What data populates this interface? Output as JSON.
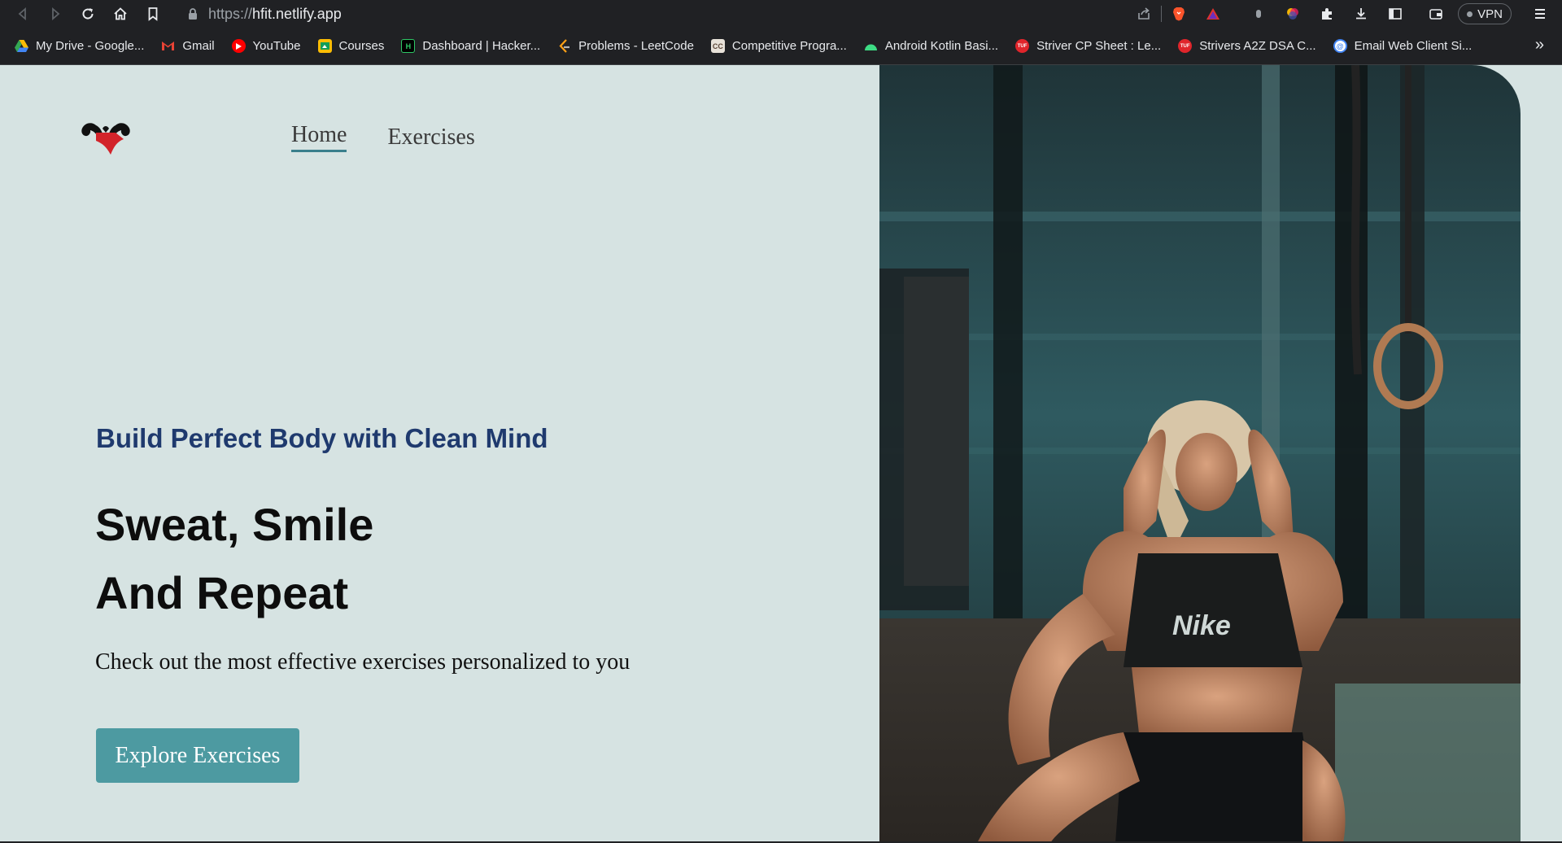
{
  "browser": {
    "url_protocol": "https://",
    "url_host": "hfit.netlify.app",
    "vpn_label": "VPN",
    "bookmarks": [
      {
        "label": "My Drive - Google...",
        "icon": "google-drive-icon",
        "color": "#34a853"
      },
      {
        "label": "Gmail",
        "icon": "gmail-icon",
        "color": "#ea4335"
      },
      {
        "label": "YouTube",
        "icon": "youtube-icon",
        "color": "#ff0000"
      },
      {
        "label": "Courses",
        "icon": "courses-icon",
        "color": "#fbbc04"
      },
      {
        "label": "Dashboard | Hacker...",
        "icon": "hackerrank-icon",
        "color": "#000000"
      },
      {
        "label": "Problems - LeetCode",
        "icon": "leetcode-icon",
        "color": "#ffa116"
      },
      {
        "label": "Competitive Progra...",
        "icon": "codechef-icon",
        "color": "#5b4638"
      },
      {
        "label": "Android Kotlin Basi...",
        "icon": "android-icon",
        "color": "#3ddc84"
      },
      {
        "label": "Striver CP Sheet : Le...",
        "icon": "tuf-icon",
        "color": "#e0252b"
      },
      {
        "label": "Strivers A2Z DSA C...",
        "icon": "tuf-icon",
        "color": "#e0252b"
      },
      {
        "label": "Email Web Client Si...",
        "icon": "email-client-icon",
        "color": "#4285f4"
      }
    ],
    "more_label": "»"
  },
  "nav": {
    "home": "Home",
    "exercises": "Exercises"
  },
  "hero": {
    "tagline": "Build Perfect Body with Clean Mind",
    "headline_line1": "Sweat, Smile",
    "headline_line2": "And Repeat",
    "subtitle": "Check out the most effective exercises personalized to you",
    "cta": "Explore Exercises"
  },
  "colors": {
    "page_bg": "#d6e3e2",
    "tagline": "#1f3a6e",
    "cta_bg": "#4d9aa1",
    "nav_underline": "#3a7f8c"
  }
}
